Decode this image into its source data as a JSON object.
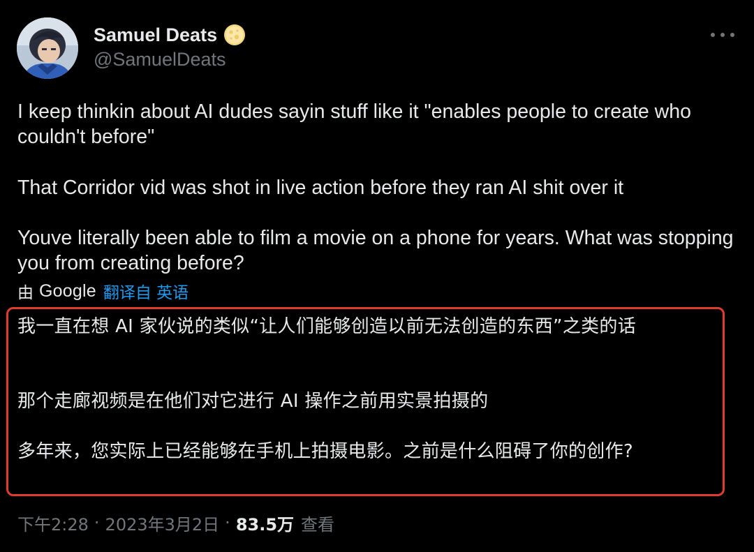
{
  "user": {
    "display_name": "Samuel Deats",
    "handle": "@SamuelDeats"
  },
  "tweet": {
    "paragraphs": [
      "I keep thinkin about AI dudes sayin stuff like it \"enables people to create who couldn't before\"",
      "That Corridor vid was shot in live action before they ran AI shit over it",
      "Youve literally been able to film a movie on a phone for years. What was stopping you from creating before?"
    ]
  },
  "translation": {
    "by_label": "由",
    "provider": "Google",
    "link_label": "翻译自 英语",
    "paragraphs": [
      "我一直在想 AI 家伙说的类似“让人们能够创造以前无法创造的东西”之类的话",
      "那个走廊视频是在他们对它进行 AI 操作之前用实景拍摄的",
      "多年来，您实际上已经能够在手机上拍摄电影。之前是什么阻碍了你的创作?"
    ]
  },
  "meta": {
    "time": "下午2:28",
    "date": "2023年3月2日",
    "separator": "·",
    "views_count": "83.5万",
    "views_label": "查看"
  },
  "colors": {
    "background": "#000000",
    "text": "#e7e9ea",
    "muted": "#71767b",
    "link": "#1d9bf0",
    "highlight_border": "#e03c2e"
  },
  "icons": {
    "badge": "moon-badge-icon",
    "more": "more-options-icon"
  }
}
